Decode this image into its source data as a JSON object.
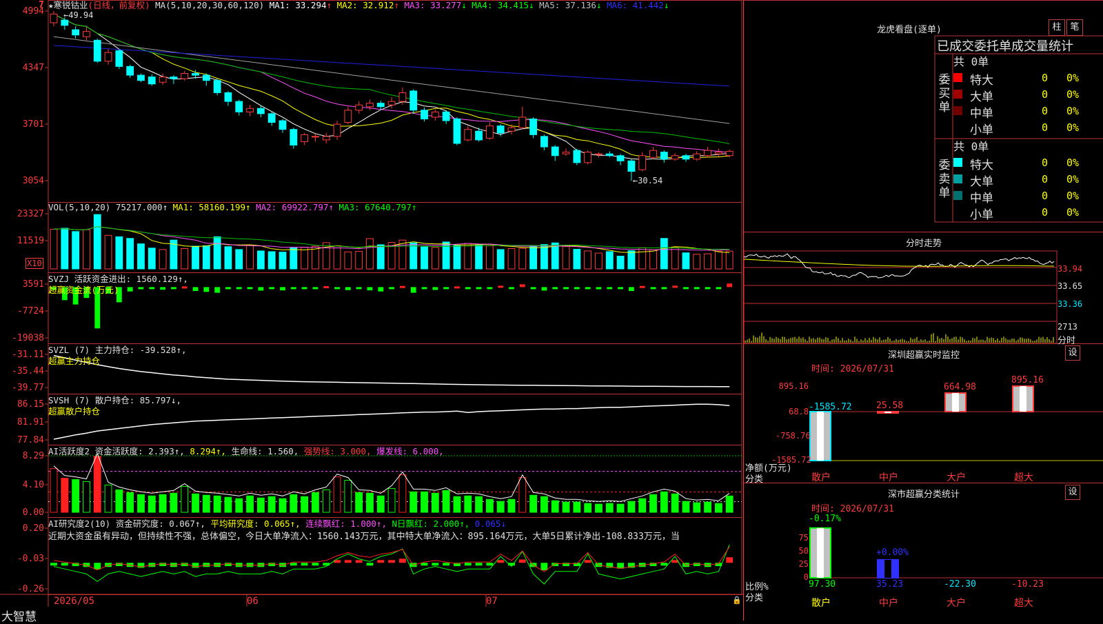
{
  "stock": {
    "star": "★",
    "name": "寒锐钴业",
    "period": "(日线，前复权)",
    "ma_label": "MA(5,10,20,30,60,120)",
    "ma": [
      {
        "label": "MA1:",
        "value": "33.294",
        "arrow": "↑",
        "color": "#ffffff"
      },
      {
        "label": "MA2:",
        "value": "32.912",
        "arrow": "↑",
        "color": "#ffff00"
      },
      {
        "label": "MA3:",
        "value": "33.277",
        "arrow": "↓",
        "color": "#ff50ff"
      },
      {
        "label": "MA4:",
        "value": "34.415",
        "arrow": "↓",
        "color": "#00ff00"
      },
      {
        "label": "MA5:",
        "value": "37.136",
        "arrow": "↓",
        "color": "#c0c0c0"
      },
      {
        "label": "MA6:",
        "value": "41.442",
        "arrow": "↓",
        "color": "#3030ff"
      }
    ],
    "top_marker": "7",
    "high_label": "49.94",
    "low_label": "30.54",
    "price_yticks": [
      "4994",
      "4347",
      "3701",
      "3054"
    ]
  },
  "vol": {
    "title": "VOL(5,10,20)",
    "value": "75217.000↑",
    "ma1": "MA1: 58160.199↑",
    "ma2": "MA2: 69922.797↑",
    "ma3": "MA3: 67640.797↑",
    "yticks": [
      "23327",
      "11519"
    ],
    "unit": "X10"
  },
  "svzj": {
    "title": "SVZJ  活跃资金进出: 1560.129↑,",
    "sub": "超赢资金流(万元)",
    "yticks": [
      "3591",
      "-7724",
      "-19038"
    ]
  },
  "svzl": {
    "title": "SVZL (7) 主力持仓: -39.528↑,",
    "sub": "超赢主力持仓",
    "yticks": [
      "-31.11",
      "-35.44",
      "-39.77"
    ]
  },
  "svsh": {
    "title": "SVSH (7) 散户持仓: 85.797↓,",
    "sub": "超赢散户持仓",
    "yticks": [
      "86.15",
      "81.91",
      "77.84"
    ]
  },
  "ai_active": {
    "title": "AI活跃度2 资金活跃度: 2.393↑,",
    "v2": "8.294↑,",
    "life": "生命线: 1.560,",
    "strong": "强势线: 3.000,",
    "burst": "爆发线: 6.000,",
    "yticks": [
      "8.29",
      "4.10",
      "0.00"
    ]
  },
  "ai_research": {
    "title": "AI研究度2(10) 资金研究度: 0.067↑,",
    "avg": "平均研究度: 0.065↑,",
    "cont": "连续飘红: 1.000↑,",
    "nday": "N日飘红: 2.000↑,",
    "last": "0.065↓",
    "comment": "近期大资金虽有异动，但持续性不强，总体偏空，今日大单净流入：1560.143万元，其中特大单净流入：895.164万元，大单5日累计净出-108.833万元，当",
    "yticks": [
      "0.20",
      "-0.03",
      "-0.26"
    ]
  },
  "xaxis": {
    "logo": "大智慧",
    "labels": [
      "2026/05",
      "06",
      "07"
    ]
  },
  "side": {
    "title": "龙虎看盘(逐单)",
    "btn1": "柱",
    "btn2": "笔",
    "sub": "已成交委托单成交量统计",
    "buy": {
      "label_chars": [
        "委",
        "买",
        "单"
      ],
      "total": "共 0单",
      "rows": [
        {
          "name": "特大",
          "vol": "0",
          "pct": "0%",
          "color": "#ff0000"
        },
        {
          "name": "大单",
          "vol": "0",
          "pct": "0%",
          "color": "#a00000"
        },
        {
          "name": "中单",
          "vol": "0",
          "pct": "0%",
          "color": "#700000"
        },
        {
          "name": "小单",
          "vol": "0",
          "pct": "0%",
          "color": "#000000"
        }
      ]
    },
    "sell": {
      "label_chars": [
        "委",
        "卖",
        "单"
      ],
      "total": "共 0单",
      "rows": [
        {
          "name": "特大",
          "vol": "0",
          "pct": "0%",
          "color": "#00ffff"
        },
        {
          "name": "大单",
          "vol": "0",
          "pct": "0%",
          "color": "#00a0a0"
        },
        {
          "name": "中单",
          "vol": "0",
          "pct": "0%",
          "color": "#007070"
        },
        {
          "name": "小单",
          "vol": "0",
          "pct": "0%",
          "color": "#000000"
        }
      ]
    },
    "intraday": {
      "title": "分时走势",
      "yticks": [
        "33.94",
        "33.65",
        "33.36"
      ],
      "vol": "2713",
      "vol_label": "分时"
    },
    "monitor": {
      "title": "深圳超赢实时监控",
      "btn": "设",
      "time": "时间: 2026/07/31",
      "yticks": [
        "895.16",
        "68.8",
        "-758.76",
        "-1585.72"
      ],
      "ylabel1": "净额(万元)",
      "ylabel2": "分类",
      "cats": [
        "散户",
        "中户",
        "大户",
        "超大"
      ]
    },
    "classify": {
      "title": "深市超赢分类统计",
      "btn": "设",
      "time": "时间: 2026/07/31",
      "yticks": [
        "75",
        "50",
        "25",
        "0"
      ],
      "ylabel1": "比例%",
      "ylabel2": "分类",
      "cats": [
        "散户",
        "中户",
        "大户",
        "超大"
      ]
    }
  },
  "chart_data": [
    {
      "type": "candlestick",
      "title": "寒锐钴业 (日线，前复权)",
      "ylim": [
        30.54,
        49.94
      ],
      "candles": [
        [
          48.6,
          49.6,
          49.94,
          48.2
        ],
        [
          48.9,
          48.3,
          49.2,
          47.8
        ],
        [
          47.8,
          47.2,
          48.2,
          46.8
        ],
        [
          47.0,
          47.6,
          48.1,
          46.6
        ],
        [
          46.6,
          44.2,
          46.8,
          44.0
        ],
        [
          44.2,
          45.2,
          45.6,
          43.8
        ],
        [
          45.4,
          43.6,
          45.6,
          43.3
        ],
        [
          43.6,
          42.6,
          43.8,
          42.3
        ],
        [
          42.6,
          42.0,
          42.8,
          41.8
        ],
        [
          42.4,
          41.6,
          42.7,
          41.4
        ],
        [
          41.8,
          42.4,
          42.8,
          41.5
        ],
        [
          42.4,
          42.2,
          42.6,
          41.6
        ],
        [
          42.2,
          42.8,
          43.1,
          42.0
        ],
        [
          42.8,
          42.6,
          43.2,
          42.2
        ],
        [
          42.6,
          42.0,
          42.8,
          41.4
        ],
        [
          42.0,
          40.6,
          42.2,
          40.3
        ],
        [
          40.6,
          39.6,
          40.8,
          39.1
        ],
        [
          39.6,
          38.4,
          39.8,
          38.0
        ],
        [
          38.4,
          38.8,
          39.2,
          37.9
        ],
        [
          38.8,
          38.2,
          39.1,
          37.8
        ],
        [
          38.2,
          37.2,
          38.4,
          36.8
        ],
        [
          37.4,
          36.4,
          37.6,
          36.0
        ],
        [
          36.4,
          34.6,
          36.6,
          34.2
        ],
        [
          35.0,
          35.8,
          36.0,
          34.6
        ],
        [
          35.6,
          35.6,
          35.9,
          35.0
        ],
        [
          35.2,
          35.6,
          36.0,
          34.8
        ],
        [
          35.6,
          37.0,
          37.4,
          35.2
        ],
        [
          37.2,
          38.6,
          39.0,
          37.0
        ],
        [
          38.6,
          39.2,
          39.6,
          38.2
        ],
        [
          39.0,
          39.4,
          39.8,
          38.6
        ],
        [
          39.4,
          39.0,
          39.7,
          38.6
        ],
        [
          39.2,
          39.6,
          40.1,
          38.8
        ],
        [
          39.6,
          40.6,
          41.2,
          39.2
        ],
        [
          40.8,
          38.6,
          41.0,
          38.2
        ],
        [
          38.6,
          37.6,
          38.9,
          37.3
        ],
        [
          37.8,
          38.4,
          38.7,
          37.4
        ],
        [
          38.4,
          37.4,
          38.6,
          37.0
        ],
        [
          37.6,
          34.8,
          37.8,
          34.6
        ],
        [
          35.2,
          36.4,
          36.8,
          35.0
        ],
        [
          36.2,
          35.2,
          36.6,
          35.0
        ],
        [
          35.4,
          36.8,
          37.2,
          35.2
        ],
        [
          36.8,
          36.0,
          37.0,
          35.6
        ],
        [
          36.2,
          36.6,
          37.0,
          35.8
        ],
        [
          36.6,
          37.8,
          39.0,
          36.4
        ],
        [
          37.6,
          35.8,
          37.8,
          35.4
        ],
        [
          35.6,
          34.4,
          35.8,
          34.0
        ],
        [
          34.4,
          33.4,
          34.6,
          32.8
        ],
        [
          33.6,
          33.8,
          34.2,
          33.4
        ],
        [
          34.0,
          32.6,
          34.2,
          32.3
        ],
        [
          32.6,
          33.8,
          34.0,
          32.4
        ],
        [
          33.6,
          33.6,
          33.8,
          33.2
        ],
        [
          33.6,
          33.4,
          33.9,
          33.2
        ],
        [
          33.4,
          32.8,
          33.6,
          32.3
        ],
        [
          32.8,
          31.6,
          33.0,
          30.54
        ],
        [
          31.8,
          33.4,
          33.8,
          31.6
        ],
        [
          33.2,
          34.0,
          34.4,
          33.0
        ],
        [
          33.8,
          33.0,
          34.0,
          32.6
        ],
        [
          33.0,
          33.4,
          33.7,
          32.8
        ],
        [
          33.4,
          33.0,
          33.6,
          32.7
        ],
        [
          33.0,
          33.6,
          33.9,
          32.8
        ],
        [
          33.4,
          34.0,
          34.4,
          33.2
        ],
        [
          33.6,
          33.8,
          34.2,
          33.3
        ],
        [
          33.4,
          33.9,
          34.1,
          33.2
        ]
      ]
    },
    {
      "type": "bar",
      "title": "VOL(5,10,20)",
      "ylim": [
        0,
        23327
      ],
      "values": [
        16800,
        17200,
        15800,
        16600,
        23000,
        14200,
        13600,
        12900,
        10600,
        8800,
        8200,
        12200,
        8600,
        9600,
        9800,
        13600,
        9400,
        8200,
        10000,
        7600,
        7300,
        7100,
        9000,
        9200,
        9600,
        11100,
        9800,
        7200,
        7400,
        12800,
        10200,
        11200,
        12200,
        11000,
        9300,
        9100,
        11400,
        10000,
        10800,
        10200,
        9800,
        8200,
        8600,
        8700,
        9400,
        10300,
        11000,
        9500,
        8300,
        7600,
        6700,
        7300,
        5400,
        7700,
        9000,
        8100,
        12900,
        9200,
        6800,
        6200,
        6400,
        7500,
        7521
      ]
    },
    {
      "type": "bar",
      "title": "SVZJ 活跃资金进出",
      "ylim": [
        -19038,
        3591
      ],
      "values": [
        -1200,
        -6000,
        -8000,
        -5000,
        -19000,
        -3000,
        -7000,
        -2000,
        -1000,
        -800,
        -1200,
        -600,
        300,
        -1800,
        -2200,
        -2600,
        -700,
        -400,
        -500,
        -1600,
        -900,
        -1500,
        -700,
        -300,
        -800,
        400,
        -600,
        -1400,
        -800,
        -1500,
        -2000,
        -900,
        500,
        -2600,
        -600,
        -1300,
        -800,
        300,
        -700,
        -500,
        -400,
        600,
        -300,
        1200,
        -900,
        -1600,
        -400,
        -800,
        -600,
        -300,
        -1000,
        -500,
        -700,
        -1800,
        500,
        -300,
        -600,
        600,
        -500,
        -400,
        -300,
        -200,
        1560
      ]
    },
    {
      "type": "line",
      "title": "SVZL 主力持仓",
      "ylim": [
        -39.77,
        -31.11
      ],
      "values": [
        -31.4,
        -32.0,
        -32.6,
        -33.2,
        -33.8,
        -34.3,
        -34.8,
        -35.2,
        -35.6,
        -35.9,
        -36.2,
        -36.5,
        -36.7,
        -37.0,
        -37.2,
        -37.4,
        -37.6,
        -37.7,
        -37.8,
        -37.9,
        -38.0,
        -38.1,
        -38.2,
        -38.25,
        -38.3,
        -38.35,
        -38.4,
        -38.45,
        -38.5,
        -38.55,
        -38.6,
        -38.65,
        -38.7,
        -38.75,
        -38.8,
        -38.85,
        -38.9,
        -38.95,
        -39.0,
        -39.05,
        -39.1,
        -39.12,
        -39.15,
        -39.18,
        -39.2,
        -39.22,
        -39.25,
        -39.28,
        -39.3,
        -39.33,
        -39.35,
        -39.38,
        -39.4,
        -39.42,
        -39.44,
        -39.46,
        -39.48,
        -39.5,
        -39.51,
        -39.52,
        -39.52,
        -39.53,
        -39.528
      ]
    },
    {
      "type": "line",
      "title": "SVSH 散户持仓",
      "ylim": [
        77.84,
        86.15
      ],
      "values": [
        78.0,
        78.5,
        79.0,
        79.4,
        79.9,
        80.2,
        80.5,
        80.8,
        81.1,
        81.4,
        81.6,
        81.8,
        82.0,
        82.2,
        82.3,
        82.4,
        82.5,
        82.6,
        82.7,
        82.8,
        82.9,
        83.0,
        83.1,
        83.2,
        83.3,
        83.4,
        83.5,
        83.6,
        83.7,
        83.8,
        83.9,
        84.0,
        84.1,
        84.2,
        84.3,
        84.3,
        84.4,
        84.5,
        84.2,
        84.4,
        84.5,
        84.6,
        84.7,
        84.8,
        84.9,
        85.0,
        85.0,
        85.1,
        85.1,
        85.2,
        85.3,
        85.4,
        85.4,
        85.5,
        85.6,
        85.7,
        85.8,
        85.9,
        86.0,
        86.1,
        86.1,
        86.0,
        85.797
      ]
    },
    {
      "type": "bar",
      "title": "AI活跃度2",
      "ylim": [
        0.0,
        8.29
      ],
      "values": [
        6.4,
        5.0,
        4.8,
        4.5,
        8.2,
        4.0,
        3.3,
        2.9,
        2.6,
        2.4,
        2.6,
        2.8,
        3.8,
        2.7,
        2.5,
        2.4,
        2.2,
        2.0,
        2.4,
        2.1,
        2.3,
        2.0,
        2.6,
        2.3,
        2.9,
        3.3,
        5.2,
        4.7,
        2.9,
        2.8,
        2.4,
        3.5,
        5.5,
        3.0,
        3.0,
        2.8,
        3.2,
        2.3,
        2.4,
        2.3,
        1.9,
        1.6,
        1.9,
        5.1,
        2.5,
        2.3,
        1.7,
        1.5,
        1.5,
        1.3,
        1.2,
        1.3,
        1.2,
        1.6,
        2.0,
        2.6,
        3.0,
        2.7,
        1.6,
        1.4,
        1.5,
        1.3,
        2.393
      ]
    },
    {
      "type": "bar",
      "title": "AI研究度2(10)",
      "ylim": [
        -0.26,
        0.2
      ],
      "values": [
        -0.02,
        -0.03,
        -0.04,
        -0.05,
        -0.08,
        -0.05,
        -0.04,
        -0.05,
        -0.06,
        -0.05,
        -0.04,
        -0.05,
        -0.04,
        -0.06,
        -0.05,
        -0.05,
        -0.04,
        -0.05,
        -0.05,
        -0.05,
        -0.04,
        -0.05,
        -0.03,
        -0.03,
        -0.03,
        -0.02,
        0.01,
        0.03,
        0.01,
        0.0,
        0.02,
        0.03,
        0.05,
        -0.05,
        -0.03,
        -0.02,
        -0.03,
        -0.04,
        -0.03,
        -0.03,
        -0.03,
        0.02,
        -0.02,
        0.04,
        -0.05,
        -0.09,
        -0.04,
        -0.04,
        -0.04,
        0.03,
        -0.05,
        -0.06,
        -0.07,
        -0.06,
        -0.05,
        -0.04,
        -0.03,
        0.02,
        -0.05,
        -0.04,
        -0.05,
        -0.04,
        0.067
      ]
    },
    {
      "type": "bar",
      "title": "深圳超赢实时监控",
      "ylim": [
        -1585.72,
        895.16
      ],
      "categories": [
        "散户",
        "中户",
        "大户",
        "超大"
      ],
      "values": [
        -1585.72,
        25.58,
        664.98,
        895.16
      ]
    },
    {
      "type": "bar",
      "title": "深市超赢分类统计",
      "ylim": [
        0,
        100
      ],
      "categories": [
        "散户",
        "中户",
        "大户",
        "超大"
      ],
      "values": [
        97.3,
        35.23,
        -22.3,
        -10.23
      ],
      "top_labels": [
        "-0.17%",
        "+0.00%",
        "",
        ""
      ]
    }
  ]
}
